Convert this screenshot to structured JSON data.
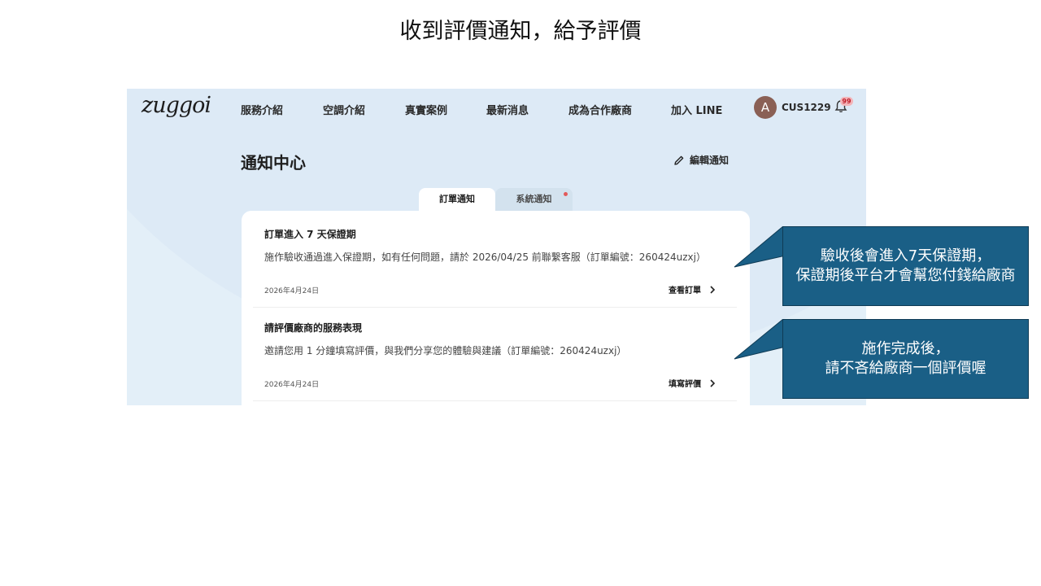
{
  "slide": {
    "title": "收到評價通知，給予評價"
  },
  "app": {
    "logo": "zuggoi",
    "nav": [
      {
        "label": "服務介紹"
      },
      {
        "label": "空調介紹"
      },
      {
        "label": "真實案例"
      },
      {
        "label": "最新消息"
      },
      {
        "label": "成為合作廠商"
      },
      {
        "label": "加入 LINE"
      }
    ],
    "user": {
      "initial": "A",
      "name": "CUS1229"
    },
    "notifications_badge": "99",
    "icons": [
      "bell-icon",
      "pencil-icon",
      "chevron-right-icon"
    ]
  },
  "page": {
    "title": "通知中心",
    "edit_label": "編輯通知",
    "tabs": [
      {
        "label": "訂單通知",
        "active": true
      },
      {
        "label": "系統通知",
        "active": false,
        "has_unread_dot": true
      }
    ]
  },
  "notifications": [
    {
      "title": "訂單進入 7 天保證期",
      "body": "施作驗收通過進入保證期，如有任何問題，請於 2026/04/25 前聯繫客服（訂單編號：260424uzxj）",
      "date": "2026年4月24日",
      "action": "查看訂單"
    },
    {
      "title": "請評價廠商的服務表現",
      "body": "邀請您用 1 分鐘填寫評價，與我們分享您的體驗與建議（訂單編號：260424uzxj）",
      "date": "2026年4月24日",
      "action": "填寫評價"
    }
  ],
  "callouts": [
    {
      "line1": "驗收後會進入7天保證期，",
      "line2": "保證期後平台才會幫您付錢給廠商"
    },
    {
      "line1": "施作完成後，",
      "line2": "請不吝給廠商一個評價喔"
    }
  ],
  "colors": {
    "callout_bg": "#1a5f86",
    "page_bg": "#e3eff8",
    "badge_text": "#c0202c",
    "unread_dot": "#e35a5a"
  }
}
